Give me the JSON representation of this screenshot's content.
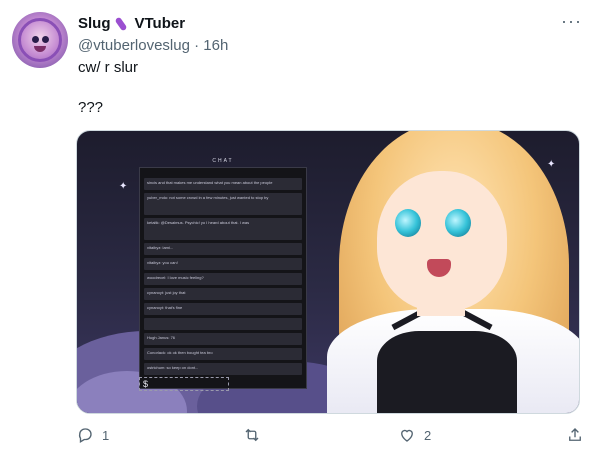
{
  "tweet": {
    "author_name": "Slug",
    "author_name_suffix": "VTuber",
    "author_handle": "@vtuberloveslug",
    "separator": "·",
    "time": "16h",
    "text_line1": "cw/ r slur",
    "text_line2": "???"
  },
  "media": {
    "chat_header": "CHAT",
    "chat_dollar": "$",
    "chat_rows": [
      "sincis and that makes me understand what you mean about the people",
      "yuber_mdo: not some crowd in a few minutes, just wanted to stop by",
      "ketaltk: @Desaimus. Psychic! yo I heard about that. I was",
      "vitaibyz: lami...",
      "vitaibyz: you can!",
      "woodrecel: I love music feeling?",
      "cynanoyt: just joy that",
      "cynanoyt: that's fine",
      "",
      "Hugh Janus: 76",
      "Conorlack: ok ok then bought tea bro",
      "ostrichum: so keep on dont..."
    ]
  },
  "actions": {
    "reply_count": "1",
    "retweet_count": "",
    "like_count": "2",
    "share_count": ""
  },
  "colors": {
    "text_primary": "#0f1419",
    "text_secondary": "#536471",
    "border": "#cfd9de"
  },
  "icons": {
    "more": "more-icon",
    "reply": "reply-icon",
    "retweet": "retweet-icon",
    "like": "like-icon",
    "share": "share-icon"
  }
}
